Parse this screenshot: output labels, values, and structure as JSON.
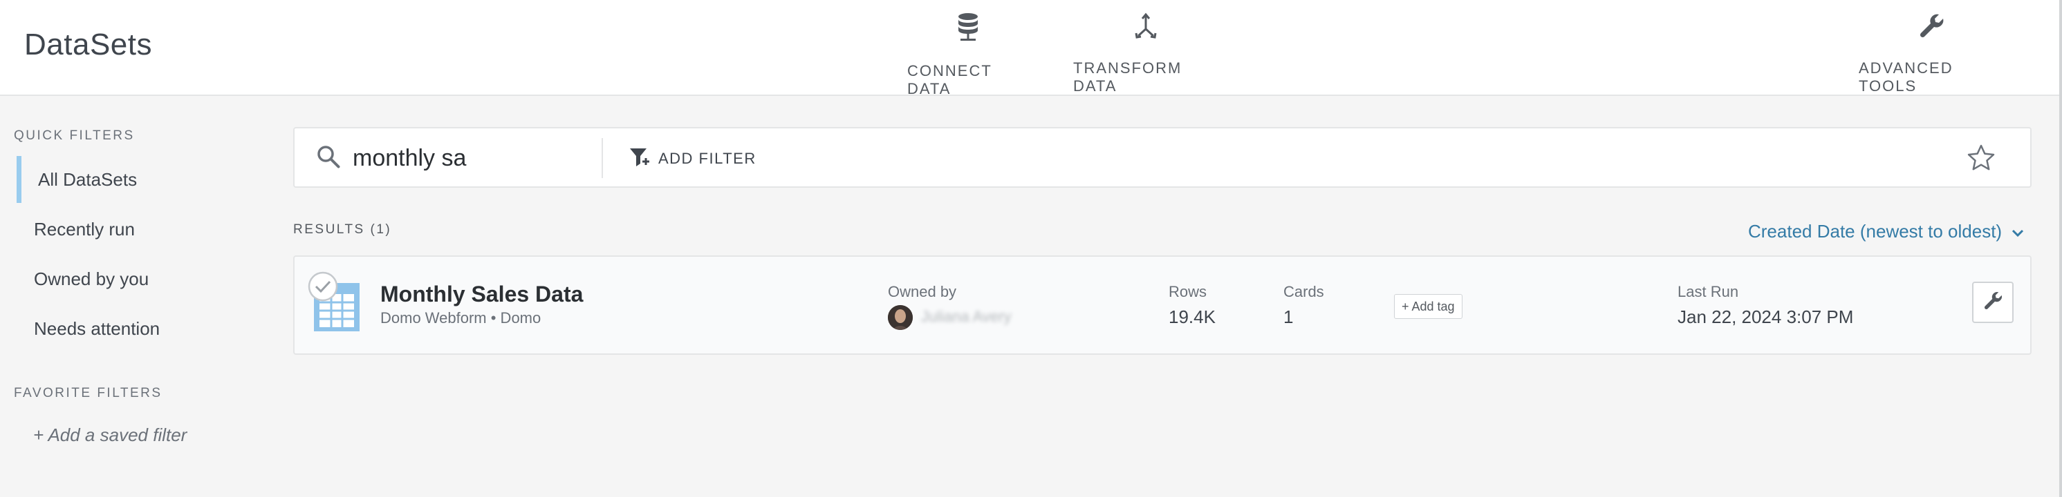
{
  "header": {
    "title": "DataSets",
    "nav": [
      {
        "label": "CONNECT DATA",
        "icon": "database-icon"
      },
      {
        "label": "TRANSFORM DATA",
        "icon": "merge-arrows-icon"
      },
      {
        "label": "ADVANCED TOOLS",
        "icon": "wrench-icon"
      }
    ]
  },
  "sidebar": {
    "quick_filters_label": "QUICK FILTERS",
    "items": [
      {
        "label": "All DataSets",
        "active": true
      },
      {
        "label": "Recently run",
        "active": false
      },
      {
        "label": "Owned by you",
        "active": false
      },
      {
        "label": "Needs attention",
        "active": false
      }
    ],
    "favorite_filters_label": "FAVORITE FILTERS",
    "add_saved_filter": "+ Add a saved filter"
  },
  "search": {
    "value": "monthly sa",
    "add_filter_label": "ADD FILTER"
  },
  "results": {
    "label": "RESULTS (1)",
    "sort_label": "Created Date (newest to oldest)",
    "items": [
      {
        "name": "Monthly Sales Data",
        "source": "Domo Webform • Domo",
        "owned_by_label": "Owned by",
        "owner_name": "Juliana Avery",
        "rows_label": "Rows",
        "rows_value": "19.4K",
        "cards_label": "Cards",
        "cards_value": "1",
        "add_tag_label": "+ Add tag",
        "last_run_label": "Last Run",
        "last_run_value": "Jan 22, 2024 3:07 PM"
      }
    ]
  },
  "colors": {
    "accent_link": "#347ba6",
    "active_filter_bar": "#99ccee",
    "dataset_icon": "#8fc3ea"
  }
}
